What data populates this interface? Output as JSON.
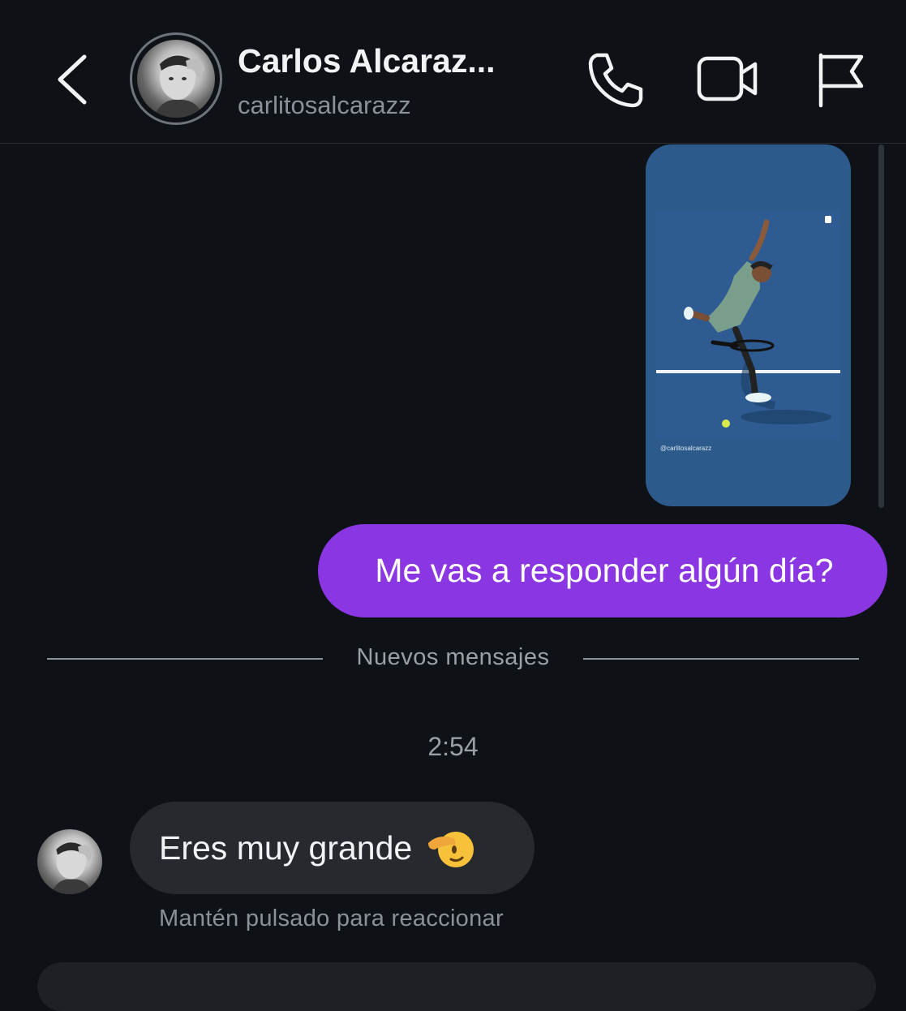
{
  "header": {
    "name": "Carlos Alcaraz...",
    "username": "carlitosalcarazz",
    "icons": [
      "chevron-left-icon",
      "phone-icon",
      "video-camera-icon",
      "flag-icon"
    ]
  },
  "story": {
    "handle": "@carlitosalcarazz"
  },
  "messages": {
    "sent_text": "Me vas a responder algún día?",
    "divider_label": "Nuevos mensajes",
    "timestamp": "2:54",
    "received_text": "Eres muy grande",
    "received_emoji": "saluting-face-emoji",
    "hint": "Mantén pulsado para reaccionar"
  },
  "colors": {
    "background": "#0e1116",
    "sent_bubble": "#8a36e2",
    "received_bubble": "#26292e",
    "muted_text": "#8b9099"
  }
}
